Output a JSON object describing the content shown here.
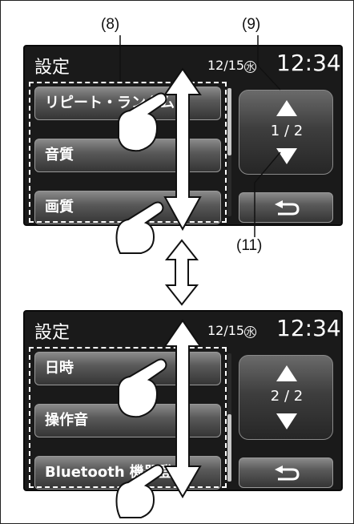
{
  "callouts": {
    "c8": "(8)",
    "c9": "(9)",
    "c11": "(11)"
  },
  "screen1": {
    "title": "設定",
    "date": "12/15",
    "weekday": "水",
    "clock": "12:34",
    "items": [
      "リピート・ランダム",
      "音質",
      "画質"
    ],
    "page": "1 / 2"
  },
  "screen2": {
    "title": "設定",
    "date": "12/15",
    "weekday": "水",
    "clock": "12:34",
    "items": [
      "日時",
      "操作音",
      "Bluetooth 機器登録"
    ],
    "page": "2 / 2"
  },
  "scroll": {
    "screen1_position": 0,
    "screen2_position": 1
  },
  "colors": {
    "screen_bg": "#1a1a1a",
    "button_top": "#8a8a8a",
    "button_bottom": "#353535",
    "text": "#ffffff"
  },
  "icons": [
    "back-arrow-icon",
    "up-triangle-icon",
    "down-triangle-icon",
    "hand-pointer-icon",
    "double-arrow-icon"
  ]
}
